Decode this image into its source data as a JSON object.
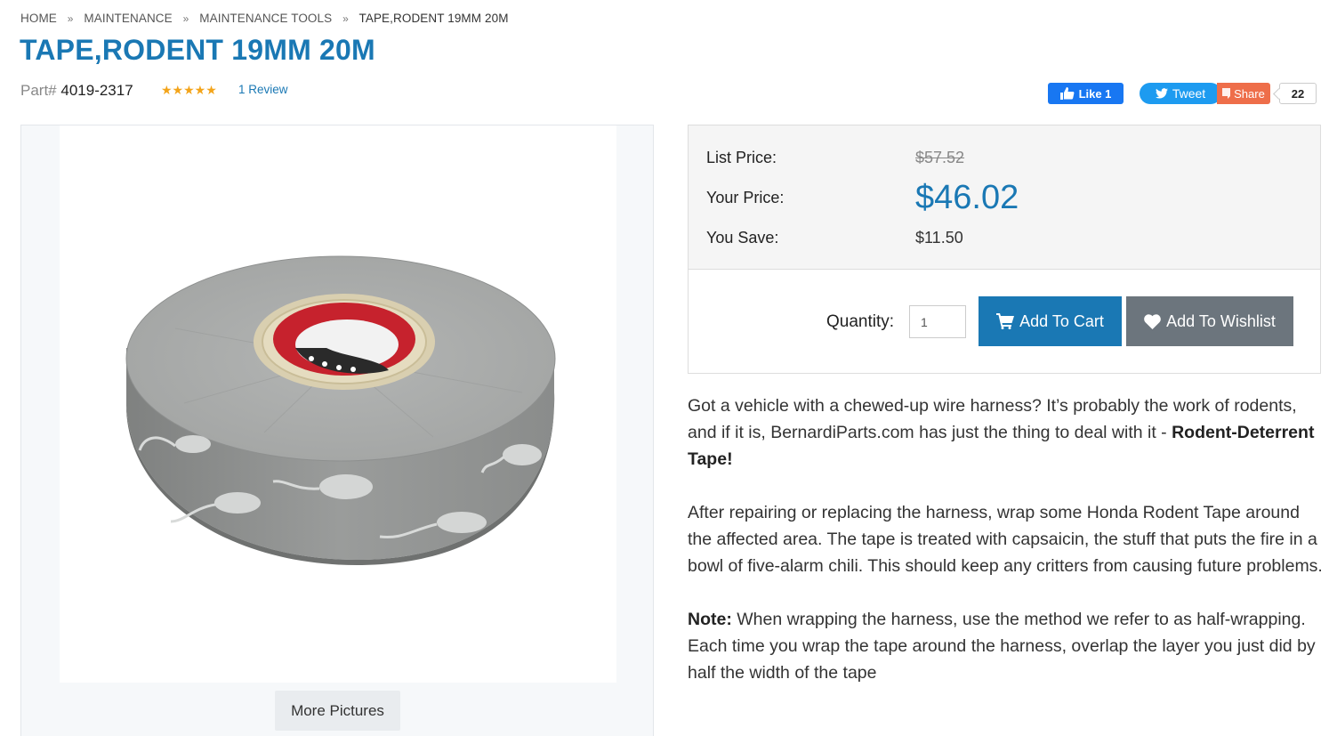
{
  "breadcrumb": {
    "items": [
      "HOME",
      "MAINTENANCE",
      "MAINTENANCE TOOLS"
    ],
    "separator": "»",
    "current": "TAPE,RODENT 19MM 20M"
  },
  "product": {
    "title": "TAPE,RODENT 19MM 20M",
    "part_label": "Part#",
    "part_number": "4019-2317",
    "rating_stars": "★★★★★",
    "rating": 5,
    "review_link": "1 Review"
  },
  "social": {
    "like_label": "Like 1",
    "tweet_label": "Tweet",
    "share_label": "Share",
    "share_count": "22"
  },
  "gallery": {
    "more_pictures": "More Pictures"
  },
  "pricing": {
    "list_label": "List Price:",
    "list_value": "$57.52",
    "your_label": "Your Price:",
    "your_value": "$46.02",
    "save_label": "You Save:",
    "save_value": "$11.50",
    "quantity_label": "Quantity:",
    "quantity_value": "1",
    "add_to_cart": "Add To Cart",
    "add_to_wishlist": "Add To Wishlist"
  },
  "description": {
    "p1_text": "Got a vehicle with a chewed-up wire harness? It’s probably the work of rodents, and if it is, BernardiParts.com has just the thing to deal with it - ",
    "p1_bold": "Rodent-Deterrent Tape!",
    "p2_text": "After repairing or replacing the harness, wrap some Honda Rodent Tape around the affected area. The tape is treated with capsaicin, the stuff that puts the fire in a bowl of five-alarm chili. This should keep any critters from causing future problems.",
    "p3_bold": "Note:",
    "p3_text": " When wrapping the harness, use the method we refer to as half-wrapping. Each time you wrap the tape around the harness, overlap the layer you just did by half the width of the tape"
  },
  "colors": {
    "accent": "#1a78b4",
    "star": "#f3a41a",
    "facebook": "#1877f2",
    "twitter": "#1d9bf0",
    "share": "#ee6e4a",
    "wishlist": "#6c757d"
  },
  "icons": [
    "thumbs-up-icon",
    "twitter-bird-icon",
    "share-icon",
    "cart-icon",
    "heart-icon"
  ]
}
